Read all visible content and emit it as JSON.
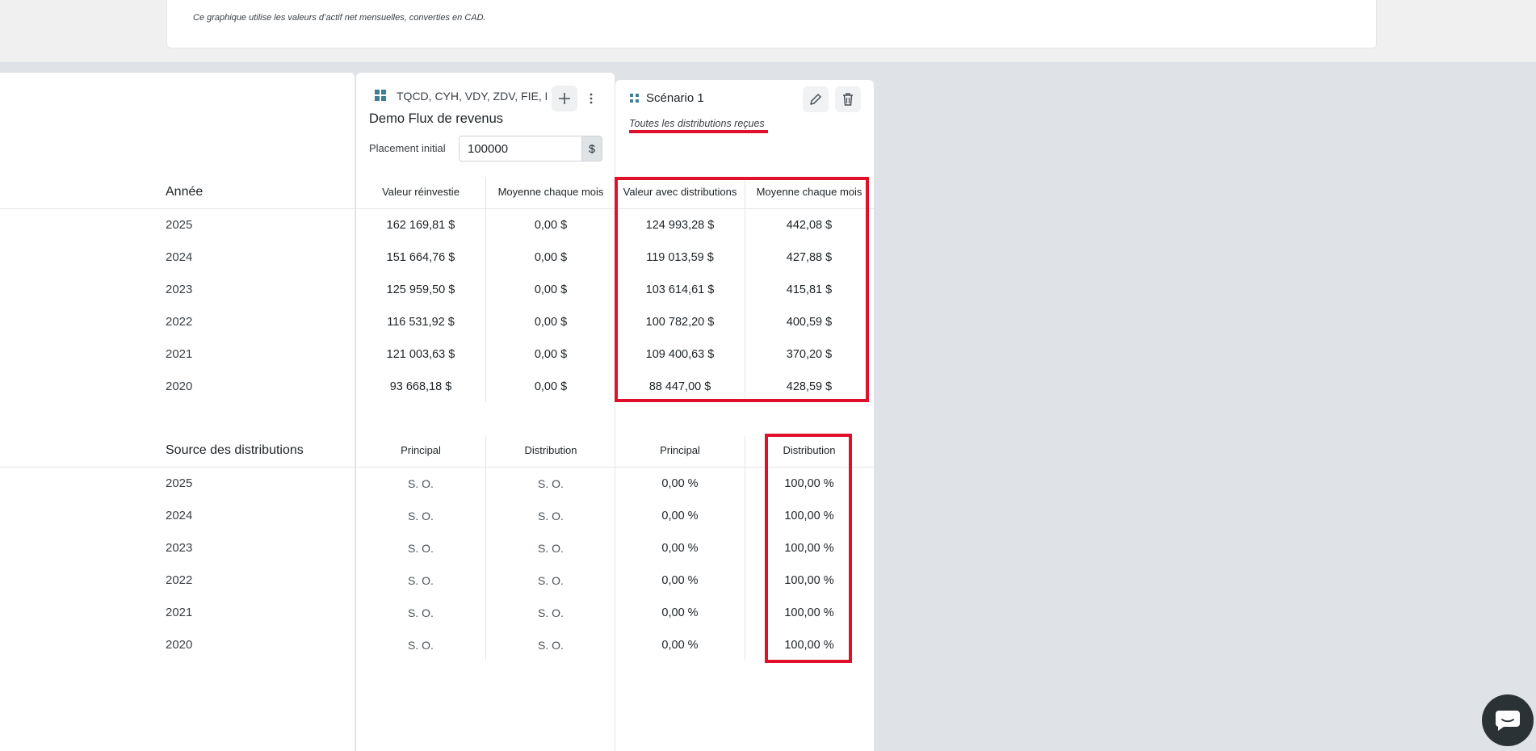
{
  "chart_note": "Ce graphique utilise les valeurs d’actif net mensuelles, converties en CAD.",
  "fund": {
    "tickers": "TQCD, CYH, VDY, ZDV, FIE, PDC",
    "title": "Demo Flux de revenus",
    "initial_label": "Placement initial",
    "initial_value": "100000",
    "currency": "$",
    "add_icon": "plus-icon",
    "menu_icon": "more-vertical-icon"
  },
  "scenario": {
    "title": "Scénario 1",
    "subtitle": "Toutes les distributions reçues",
    "edit_icon": "pencil-icon",
    "delete_icon": "trash-icon"
  },
  "values_table": {
    "row_header": "Année",
    "columns": [
      "Valeur réinvestie",
      "Moyenne chaque mois",
      "Valeur avec distributions",
      "Moyenne chaque mois"
    ],
    "rows": [
      {
        "year": "2025",
        "cells": [
          "162 169,81 $",
          "0,00 $",
          "124 993,28 $",
          "442,08 $"
        ]
      },
      {
        "year": "2024",
        "cells": [
          "151 664,76 $",
          "0,00 $",
          "119 013,59 $",
          "427,88 $"
        ]
      },
      {
        "year": "2023",
        "cells": [
          "125 959,50 $",
          "0,00 $",
          "103 614,61 $",
          "415,81 $"
        ]
      },
      {
        "year": "2022",
        "cells": [
          "116 531,92 $",
          "0,00 $",
          "100 782,20 $",
          "400,59 $"
        ]
      },
      {
        "year": "2021",
        "cells": [
          "121 003,63 $",
          "0,00 $",
          "109 400,63 $",
          "370,20 $"
        ]
      },
      {
        "year": "2020",
        "cells": [
          "93 668,18 $",
          "0,00 $",
          "88 447,00 $",
          "428,59 $"
        ]
      }
    ]
  },
  "source_table": {
    "row_header": "Source des distributions",
    "columns": [
      "Principal",
      "Distribution",
      "Principal",
      "Distribution"
    ],
    "rows": [
      {
        "year": "2025",
        "cells": [
          "S. O.",
          "S. O.",
          "0,00 %",
          "100,00 %"
        ]
      },
      {
        "year": "2024",
        "cells": [
          "S. O.",
          "S. O.",
          "0,00 %",
          "100,00 %"
        ]
      },
      {
        "year": "2023",
        "cells": [
          "S. O.",
          "S. O.",
          "0,00 %",
          "100,00 %"
        ]
      },
      {
        "year": "2022",
        "cells": [
          "S. O.",
          "S. O.",
          "0,00 %",
          "100,00 %"
        ]
      },
      {
        "year": "2021",
        "cells": [
          "S. O.",
          "S. O.",
          "0,00 %",
          "100,00 %"
        ]
      },
      {
        "year": "2020",
        "cells": [
          "S. O.",
          "S. O.",
          "0,00 %",
          "100,00 %"
        ]
      }
    ]
  },
  "colors": {
    "highlight": "#e0102a",
    "accent": "#3b7e96",
    "background": "#dfe3e7"
  },
  "chat_icon": "chat-bubble-icon"
}
